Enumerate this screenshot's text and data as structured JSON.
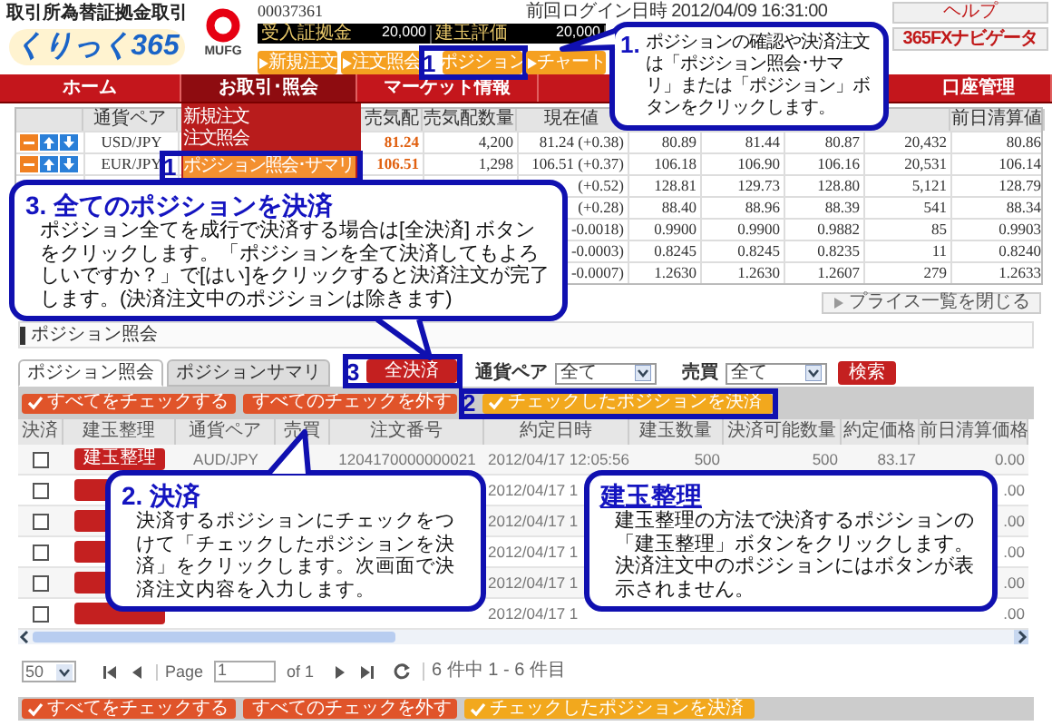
{
  "header": {
    "logo_caption": "取引所為替証拠金取引",
    "logo": "くりっく365",
    "bank_logo": "MUFG",
    "account_no": "00037361",
    "balances": [
      {
        "label": "受入証拠金",
        "value": "20,000"
      },
      {
        "label": "建玉評価",
        "value": "20,000"
      }
    ],
    "quick_buttons": [
      {
        "label": "新規注文"
      },
      {
        "label": "注文照会"
      },
      {
        "label": "ポジション",
        "marker": "1"
      },
      {
        "label": "チャート"
      }
    ],
    "last_login": "前回ログイン日時 2012/04/09 16:31:00",
    "help": "ヘルプ",
    "navigator": "365FXナビゲータ"
  },
  "nav": [
    {
      "label": "ホーム",
      "selected": false
    },
    {
      "label": "お取引･照会",
      "selected": true
    },
    {
      "label": "マーケット情報",
      "selected": false
    },
    {
      "label": "口座管理",
      "selected": false
    }
  ],
  "menu": [
    {
      "label": "新規注文",
      "selected": false
    },
    {
      "label": "注文照会",
      "selected": false
    },
    {
      "label": "ポジション照会･サマリ",
      "selected": true,
      "marker": "1"
    }
  ],
  "price_table": {
    "columns": {
      "pair": "通貨ペア",
      "bid": "売気配",
      "bid_qty": "売気配数量",
      "last": "現在値",
      "prev_close": "前日清算値"
    },
    "rows": [
      {
        "pair": "USD/JPY",
        "bid": "81.24",
        "bid_qty": "4,200",
        "last": "81.24 (+0.38)",
        "column_6": "80.89",
        "column_7": "81.44",
        "column_8": "80.87",
        "column_9": "20,432",
        "prev_close": "80.86"
      },
      {
        "pair": "EUR/JPY",
        "bid": "106.51",
        "bid_qty": "1,298",
        "last": "106.51 (+0.37)",
        "column_6": "106.18",
        "column_7": "106.90",
        "column_8": "106.16",
        "column_9": "20,531",
        "prev_close": "106.14"
      },
      {
        "last": "(+0.52)",
        "column_6": "128.81",
        "column_7": "129.73",
        "column_8": "128.80",
        "column_9": "5,121",
        "prev_close": "128.79"
      },
      {
        "last": "(+0.28)",
        "column_6": "88.40",
        "column_7": "88.96",
        "column_8": "88.39",
        "column_9": "541",
        "prev_close": "88.34"
      },
      {
        "last": "-0.0018)",
        "column_6": "0.9900",
        "column_7": "0.9900",
        "column_8": "0.9882",
        "column_9": "85",
        "prev_close": "0.9903"
      },
      {
        "last": "-0.0003)",
        "column_6": "0.8245",
        "column_7": "0.8245",
        "column_8": "0.8235",
        "column_9": "11",
        "prev_close": "0.8240"
      },
      {
        "last": "-0.0007)",
        "column_6": "1.2630",
        "column_7": "1.2630",
        "column_8": "1.2607",
        "column_9": "279",
        "prev_close": "1.2633"
      }
    ],
    "close_button": "プライス一覧を閉じる"
  },
  "section_title": "ポジション照会",
  "tabs": [
    {
      "label": "ポジション照会",
      "selected": true
    },
    {
      "label": "ポジションサマリ",
      "selected": false
    }
  ],
  "settle_all": {
    "label": "全決済",
    "marker": "3"
  },
  "filters": [
    {
      "label": "通貨ペア",
      "value": "全て"
    },
    {
      "label": "売買",
      "value": "全て"
    }
  ],
  "search_button": "検索",
  "actions": [
    {
      "label": "すべてをチェックする",
      "kind": "normal"
    },
    {
      "label": "すべてのチェックを外す",
      "kind": "normal"
    },
    {
      "label": "チェックしたポジションを決済",
      "kind": "primary",
      "marker": "2"
    }
  ],
  "positions": {
    "columns": [
      "決済",
      "建玉整理",
      "通貨ペア",
      "売買",
      "注文番号",
      "約定日時",
      "建玉数量",
      "決済可能数量",
      "約定価格",
      "前日清算価格"
    ],
    "rows": [
      {
        "checked": false,
        "has_tidy_button": true,
        "tidy_label": "建玉整理",
        "pair": "AUD/JPY",
        "order_no": "1204170000000021",
        "time": "2012/04/17 12:05:56",
        "qty": "500",
        "settleable": "500",
        "price": "83.17",
        "prev_price": "0.00"
      },
      {
        "checked": false,
        "has_tidy_button": true,
        "time": "2012/04/17 1",
        "prev_price": ".00"
      },
      {
        "checked": false,
        "has_tidy_button": true,
        "time": "2012/04/17 1",
        "prev_price": ".00"
      },
      {
        "checked": false,
        "has_tidy_button": true,
        "time": "2012/04/17 1",
        "prev_price": ".00"
      },
      {
        "checked": false,
        "has_tidy_button": true,
        "time": "2012/04/17 1",
        "prev_price": ".00"
      },
      {
        "checked": false,
        "has_tidy_button": true,
        "time": "2012/04/17 1",
        "prev_price": ".00"
      }
    ]
  },
  "pager": {
    "page_size": "50",
    "page_label": "Page",
    "page": "1",
    "of": "of 1",
    "summary": "6 件中 1 - 6 件目"
  },
  "bottom_actions": [
    {
      "label": "すべてをチェックする",
      "kind": "normal"
    },
    {
      "label": "すべてのチェックを外す",
      "kind": "normal"
    },
    {
      "label": "チェックしたポジションを決済",
      "kind": "primary"
    }
  ],
  "callouts": [
    {
      "kind": "step1",
      "title": "1.",
      "underlined": false,
      "body": "ポジションの確認や決済注文は「ポジション照会･サマリ」または「ポジション」ボタンをクリックします。"
    },
    {
      "kind": "step3",
      "title": "3. 全てのポジションを決済",
      "underlined": false,
      "body": "ポジション全てを成行で決済する場合は[全決済] ボタンをクリックします。「ポジションを全て決済してもよろしいですか？」で[はい]をクリックすると決済注文が完了します。(決済注文中のポジションは除きます)"
    },
    {
      "kind": "step2",
      "title": "2. 決済",
      "underlined": false,
      "body": "決済するポジションにチェックをつけて「チェックしたポジションを決済」をクリックします。次画面で決済注文内容を入力します。"
    },
    {
      "kind": "tidy",
      "title": "建玉整理",
      "underlined": true,
      "body": "建玉整理の方法で決済するポジションの「建玉整理」ボタンをクリックします。決済注文中のポジションにはボタンが表示されません。"
    }
  ]
}
